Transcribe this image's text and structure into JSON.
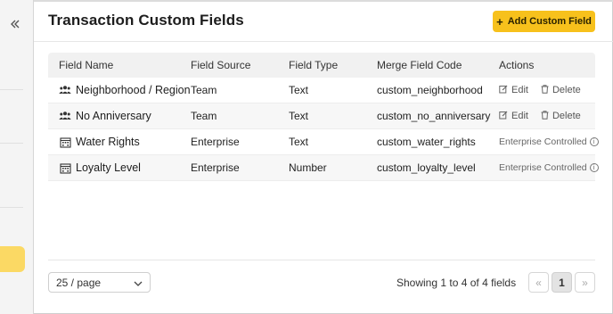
{
  "sidebar": {
    "collapse_icon": "double-chevron-left-icon",
    "active_color": "#fbd964"
  },
  "header": {
    "title": "Transaction Custom Fields",
    "add_button_label": "Add Custom Field",
    "add_button_color": "#f7c11c"
  },
  "table": {
    "columns": [
      "Field Name",
      "Field Source",
      "Field Type",
      "Merge Field Code",
      "Actions"
    ],
    "rows": [
      {
        "icon": "team-icon",
        "name": "Neighborhood / Region",
        "source": "Team",
        "type": "Text",
        "code": "custom_neighborhood",
        "edit_label": "Edit",
        "delete_label": "Delete"
      },
      {
        "icon": "team-icon",
        "name": "No Anniversary",
        "source": "Team",
        "type": "Text",
        "code": "custom_no_anniversary",
        "edit_label": "Edit",
        "delete_label": "Delete"
      },
      {
        "icon": "building-icon",
        "name": "Water Rights",
        "source": "Enterprise",
        "type": "Text",
        "code": "custom_water_rights",
        "controlled_label": "Enterprise Controlled"
      },
      {
        "icon": "building-icon",
        "name": "Loyalty Level",
        "source": "Enterprise",
        "type": "Number",
        "code": "custom_loyalty_level",
        "controlled_label": "Enterprise Controlled"
      }
    ]
  },
  "footer": {
    "page_size": "25 / page",
    "summary": "Showing 1 to 4 of 4 fields",
    "prev_label": "«",
    "current_page": "1",
    "next_label": "»"
  }
}
